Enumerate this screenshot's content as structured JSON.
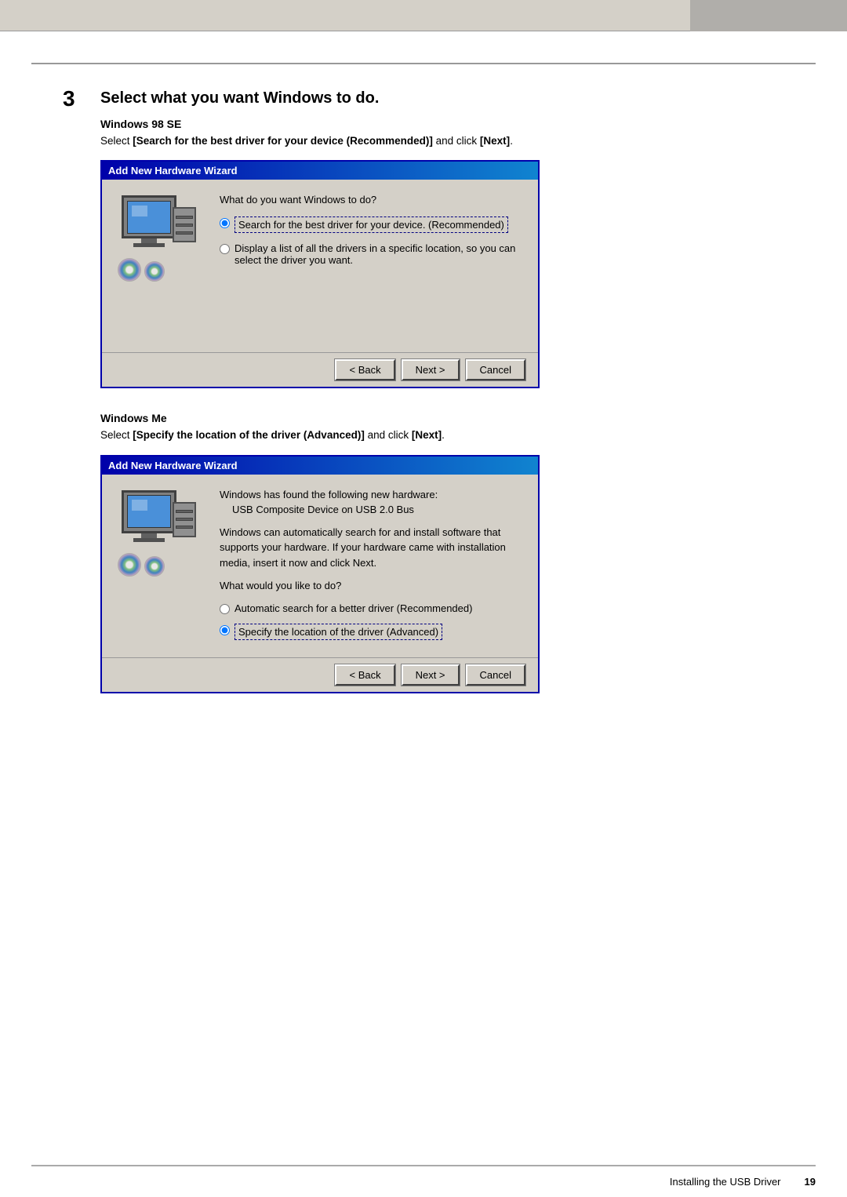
{
  "top_bar": {
    "gray_block": ""
  },
  "step": {
    "number": "3",
    "title": "Select what you want Windows to do.",
    "windows98": {
      "os_label": "Windows 98 SE",
      "instruction_prefix": "Select ",
      "instruction_bold": "[Search for the best driver for your device (Recommended)]",
      "instruction_suffix": " and click ",
      "instruction_click": "[Next]",
      "instruction_period": "."
    },
    "wizard1": {
      "titlebar": "Add New Hardware Wizard",
      "question": "What do you want Windows to do?",
      "option1_label": "Search for the best driver for your device. (Recommended)",
      "option1_selected": true,
      "option2_label": "Display a list of all the drivers in a specific location, so you can select the driver you want.",
      "option2_selected": false,
      "back_button": "< Back",
      "next_button": "Next >",
      "cancel_button": "Cancel"
    },
    "windowsMe": {
      "os_label": "Windows Me",
      "instruction_prefix": "Select ",
      "instruction_bold": "[Specify the location of the driver (Advanced)]",
      "instruction_suffix": " and click ",
      "instruction_click": "[Next]",
      "instruction_period": "."
    },
    "wizard2": {
      "titlebar": "Add New Hardware Wizard",
      "found_text": "Windows has found the following new hardware:",
      "hardware_name": "USB Composite Device on USB 2.0 Bus",
      "auto_text": "Windows can automatically search for and install software that supports your hardware. If your hardware came with installation media, insert it now and click Next.",
      "question": "What would you like to do?",
      "option1_label": "Automatic search for a better driver (Recommended)",
      "option1_selected": false,
      "option2_label": "Specify the location of the driver (Advanced)",
      "option2_selected": true,
      "back_button": "< Back",
      "next_button": "Next >",
      "cancel_button": "Cancel"
    }
  },
  "footer": {
    "left_text": "Installing the USB Driver",
    "page_number": "19"
  }
}
